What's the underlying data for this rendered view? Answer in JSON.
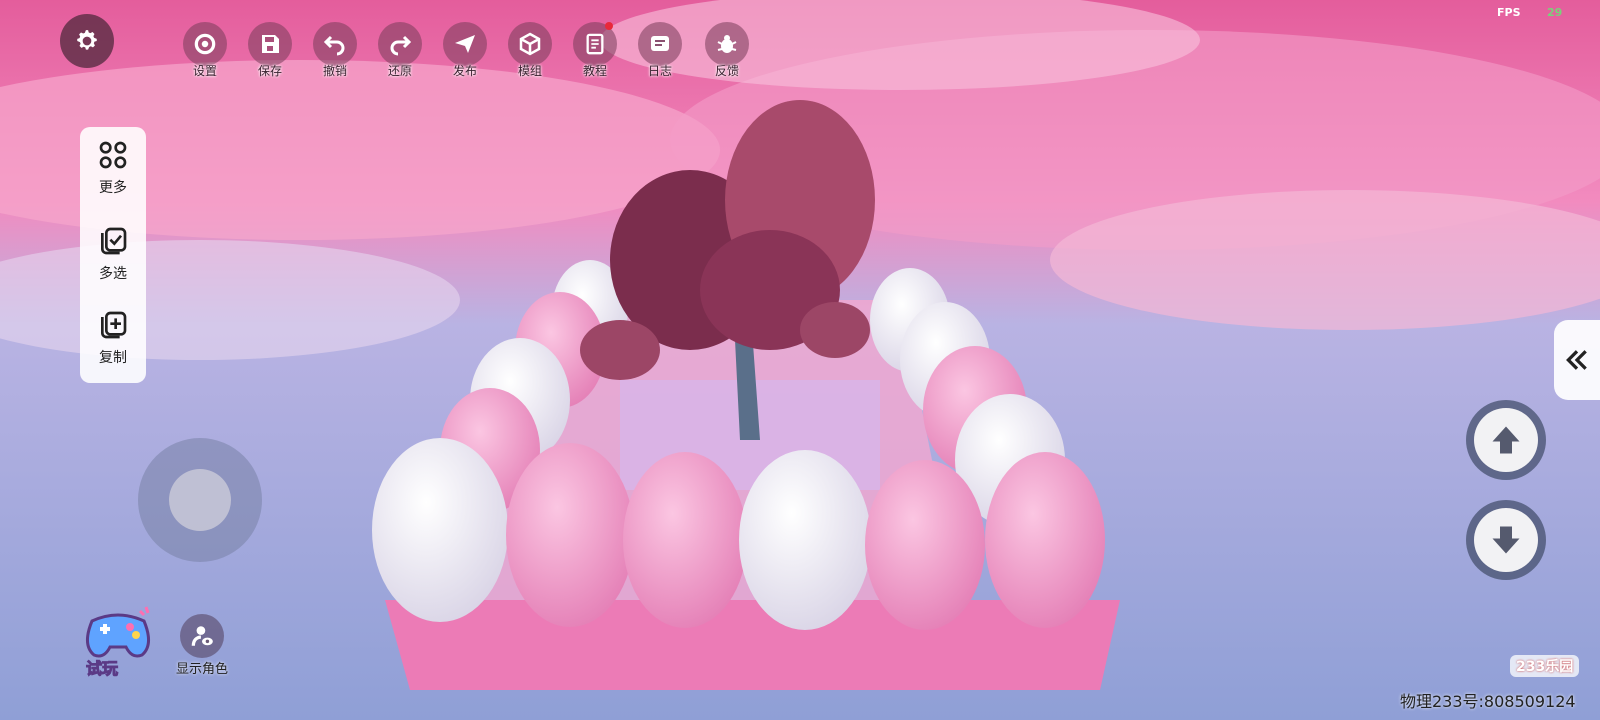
{
  "toolbar": {
    "items": [
      {
        "label": "设置",
        "icon": "settings-icon"
      },
      {
        "label": "保存",
        "icon": "save-icon"
      },
      {
        "label": "撤销",
        "icon": "undo-icon"
      },
      {
        "label": "还原",
        "icon": "redo-icon"
      },
      {
        "label": "发布",
        "icon": "publish-icon"
      },
      {
        "label": "模组",
        "icon": "module-icon"
      },
      {
        "label": "教程",
        "icon": "tutorial-icon"
      },
      {
        "label": "日志",
        "icon": "log-icon"
      },
      {
        "label": "反馈",
        "icon": "feedback-icon"
      }
    ]
  },
  "sidepanel": {
    "more": "更多",
    "multiselect": "多选",
    "copy": "复制"
  },
  "bottom": {
    "try": "试玩",
    "show_character": "显示角色"
  },
  "hud": {
    "fps_label": "FPS",
    "fps_value": "29"
  },
  "watermark": {
    "logo": "233乐园",
    "id": "物理233号:808509124"
  },
  "colors": {
    "accent": "#e4709e",
    "sky_pink": "#f06aaa",
    "sky_blue": "#8f9fd6"
  }
}
